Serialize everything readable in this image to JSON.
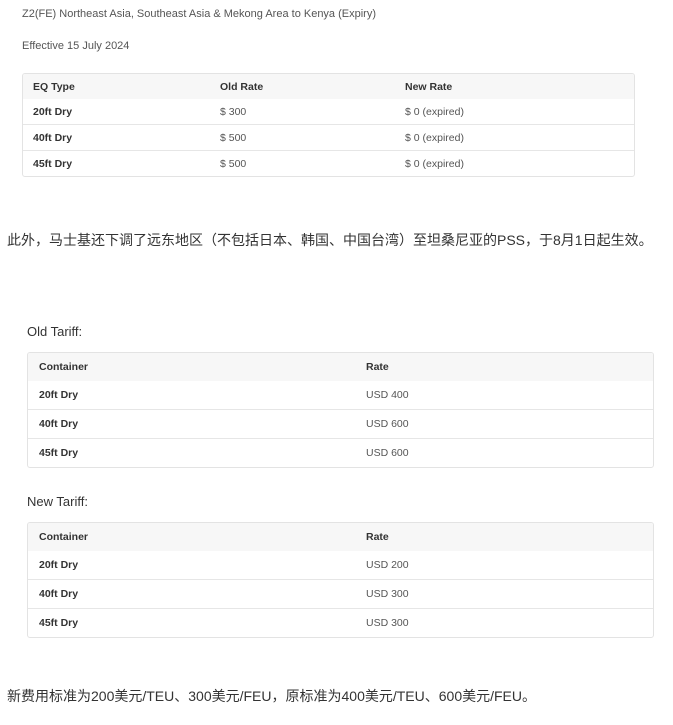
{
  "header": {
    "route_title": "Z2(FE) Northeast Asia, Southeast Asia & Mekong Area to Kenya (Expiry)",
    "effective": "Effective 15 July 2024"
  },
  "rate_table": {
    "columns": [
      "EQ Type",
      "Old Rate",
      "New Rate"
    ],
    "rows": [
      [
        "20ft Dry",
        "$ 300",
        "$ 0 (expired)"
      ],
      [
        "40ft Dry",
        "$ 500",
        "$ 0 (expired)"
      ],
      [
        "45ft Dry",
        "$ 500",
        "$ 0 (expired)"
      ]
    ]
  },
  "paragraph1": "此外，马士基还下调了远东地区（不包括日本、韩国、中国台湾）至坦桑尼亚的PSS，于8月1日起生效。",
  "old_tariff": {
    "label": "Old Tariff:",
    "columns": [
      "Container",
      "Rate"
    ],
    "rows": [
      [
        "20ft Dry",
        "USD 400"
      ],
      [
        "40ft Dry",
        "USD 600"
      ],
      [
        "45ft Dry",
        "USD 600"
      ]
    ]
  },
  "new_tariff": {
    "label": "New Tariff:",
    "columns": [
      "Container",
      "Rate"
    ],
    "rows": [
      [
        "20ft Dry",
        "USD 200"
      ],
      [
        "40ft Dry",
        "USD 300"
      ],
      [
        "45ft Dry",
        "USD 300"
      ]
    ]
  },
  "paragraph2": "新费用标准为200美元/TEU、300美元/FEU，原标准为400美元/TEU、600美元/FEU。"
}
